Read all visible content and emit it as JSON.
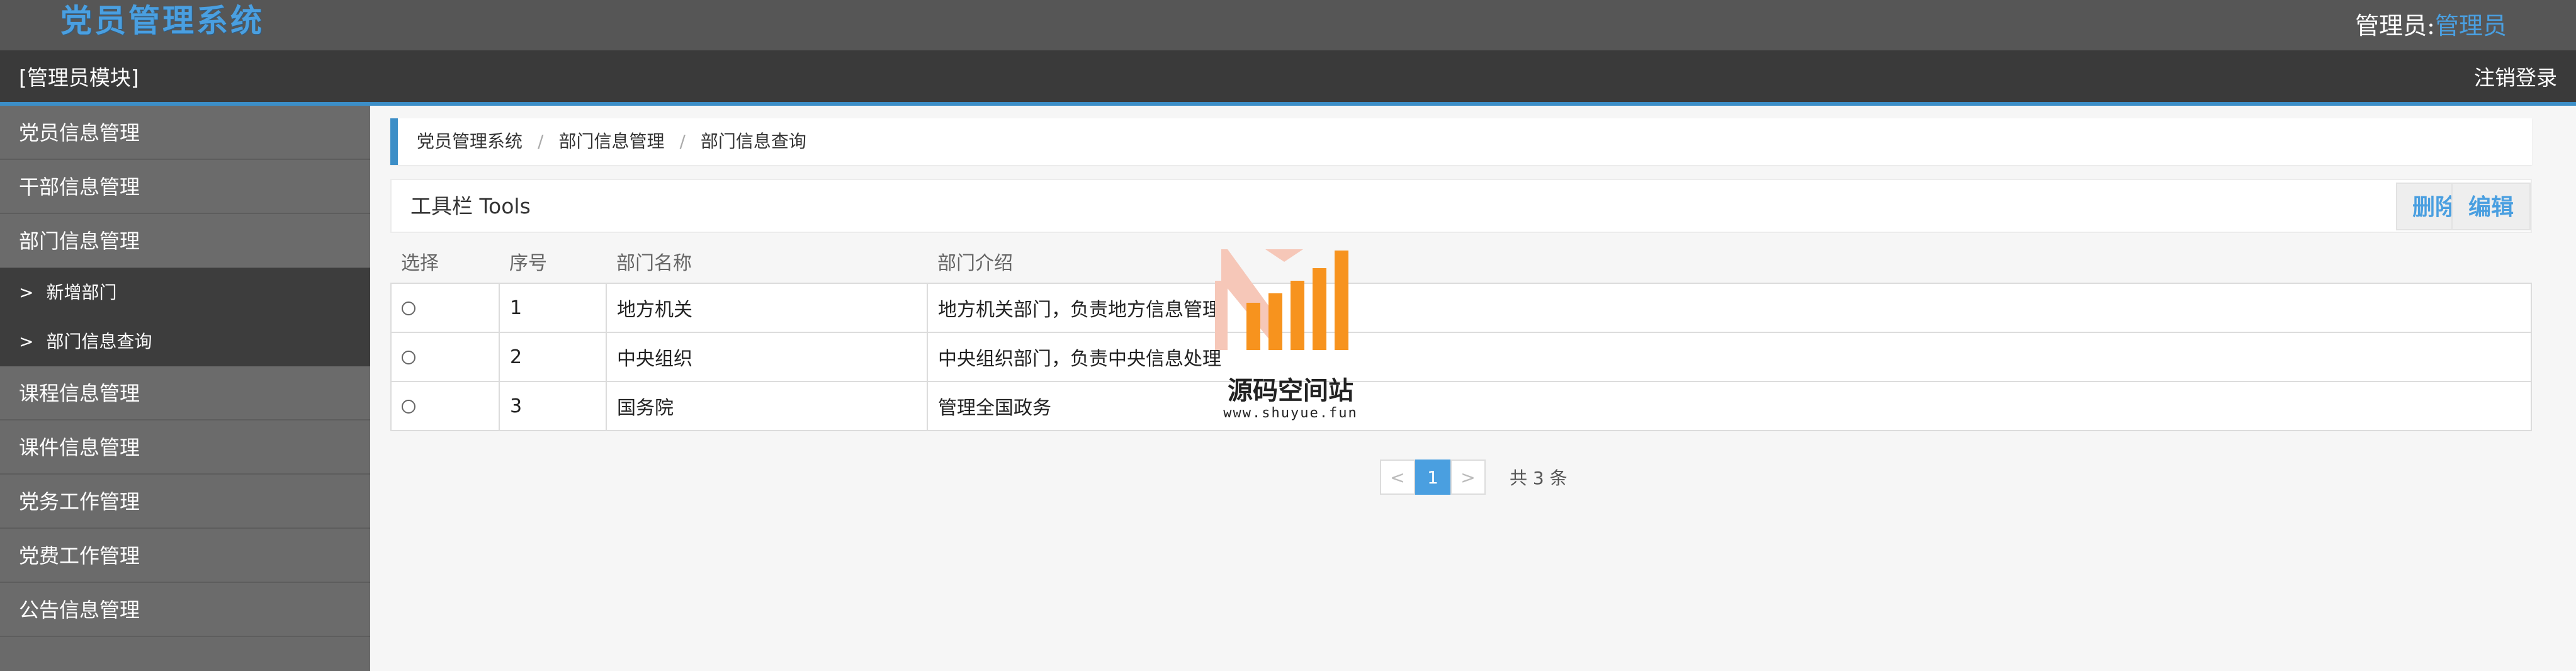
{
  "header": {
    "app_title": "党员管理系统",
    "admin_label": "管理员:",
    "admin_name": "管理员"
  },
  "module_bar": {
    "module_title": "[管理员模块]",
    "logout_label": "注销登录"
  },
  "sidebar": {
    "items_top": [
      {
        "label": "党员信息管理"
      },
      {
        "label": "干部信息管理"
      },
      {
        "label": "部门信息管理"
      }
    ],
    "sub_items": [
      {
        "arrow": ">",
        "label": "新增部门"
      },
      {
        "arrow": ">",
        "label": "部门信息查询"
      }
    ],
    "items_bottom": [
      {
        "label": "课程信息管理"
      },
      {
        "label": "课件信息管理"
      },
      {
        "label": "党务工作管理"
      },
      {
        "label": "党费工作管理"
      },
      {
        "label": "公告信息管理"
      }
    ]
  },
  "breadcrumb": [
    "党员管理系统",
    "部门信息管理",
    "部门信息查询"
  ],
  "toolbar": {
    "title": "工具栏 Tools",
    "delete_label": "删除",
    "edit_label": "编辑"
  },
  "table": {
    "headers": [
      "选择",
      "序号",
      "部门名称",
      "部门介绍"
    ],
    "rows": [
      {
        "no": "1",
        "name": "地方机关",
        "intro": "地方机关部门，负责地方信息管理"
      },
      {
        "no": "2",
        "name": "中央组织",
        "intro": "中央组织部门，负责中央信息处理"
      },
      {
        "no": "3",
        "name": "国务院",
        "intro": "管理全国政务"
      }
    ]
  },
  "pagination": {
    "prev": "<",
    "current": "1",
    "next": ">",
    "total_text": "共 3 条"
  },
  "watermark": {
    "title": "源码空间站",
    "url": "www.shuyue.fun"
  },
  "colors": {
    "accent": "#4a9fe0",
    "header_bg": "#565656",
    "module_bg": "#3a3a3a",
    "sidebar_bg": "#6b6b6b",
    "sidebar_sub_bg": "#3d3d3d",
    "watermark_orange": "#f7931e"
  }
}
